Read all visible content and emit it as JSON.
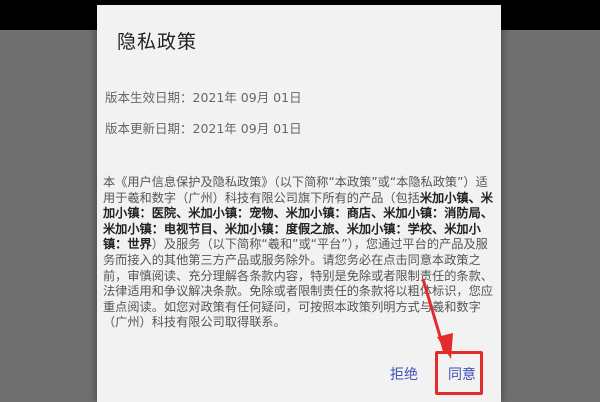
{
  "dialog": {
    "title": "隐私政策",
    "effective_date": "版本生效日期：2021年 09月 01日",
    "update_date": "版本更新日期：2021年 09月 01日",
    "policy_segments": [
      {
        "text": "本《用户信息保护及隐私政策》（以下简称“本政策”或“本隐私政策”）适用于羲和数字（广州）科技有限公司旗下所有的产品（包括",
        "bold": false
      },
      {
        "text": "米加小镇、米加小镇：医院、米加小镇：宠物、米加小镇：商店、米加小镇：消防局、米加小镇：电视节目、米加小镇：度假之旅、米加小镇：学校、米加小镇：世界",
        "bold": true
      },
      {
        "text": "）及服务（以下简称“羲和”或“平台”），您通过平台的产品及服务而接入的其他第三方产品或服务除外。请您务必在点击同意本政策之前，审慎阅读、充分理解各条款内容，特别是免除或者限制责任的条款、法律适用和争议解决条款。免除或者限制责任的条款将以粗体标识，您应重点阅读。如您对政策有任何疑问，可按照本政策列明方式与羲和数字（广州）科技有限公司取得联系。",
        "bold": false
      }
    ],
    "reject_label": "拒绝",
    "agree_label": "同意"
  },
  "colors": {
    "accent": "#3f51b5",
    "highlight": "#e42b2b",
    "overlay": "#6f6f6f"
  }
}
